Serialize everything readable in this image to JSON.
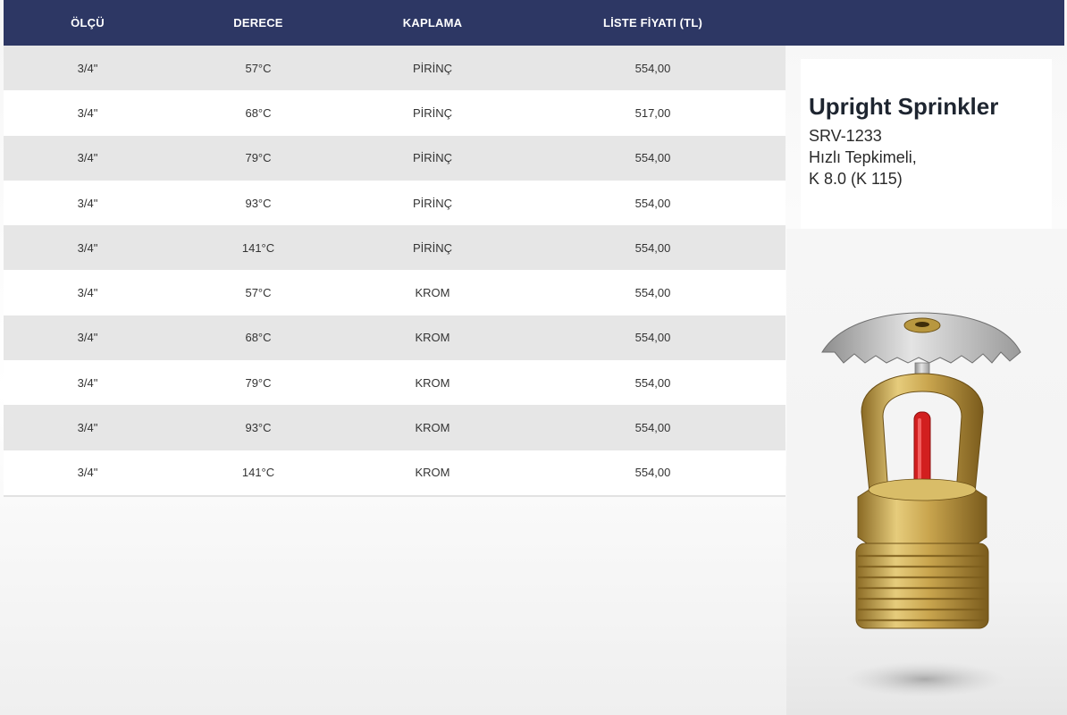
{
  "table": {
    "headers": [
      "ÖLÇÜ",
      "DERECE",
      "KAPLAMA",
      "LİSTE FİYATI (TL)"
    ],
    "rows": [
      [
        "3/4\"",
        "57°C",
        "PİRİNÇ",
        "554,00"
      ],
      [
        "3/4\"",
        "68°C",
        "PİRİNÇ",
        "517,00"
      ],
      [
        "3/4\"",
        "79°C",
        "PİRİNÇ",
        "554,00"
      ],
      [
        "3/4\"",
        "93°C",
        "PİRİNÇ",
        "554,00"
      ],
      [
        "3/4\"",
        "141°C",
        "PİRİNÇ",
        "554,00"
      ],
      [
        "3/4\"",
        "57°C",
        "KROM",
        "554,00"
      ],
      [
        "3/4\"",
        "68°C",
        "KROM",
        "554,00"
      ],
      [
        "3/4\"",
        "79°C",
        "KROM",
        "554,00"
      ],
      [
        "3/4\"",
        "93°C",
        "KROM",
        "554,00"
      ],
      [
        "3/4\"",
        "141°C",
        "KROM",
        "554,00"
      ]
    ]
  },
  "product": {
    "title": "Upright Sprinkler",
    "code": "SRV-1233",
    "response": "Hızlı Tepkimeli,",
    "k_factor": "K 8.0 (K 115)"
  },
  "colors": {
    "header_bg": "#2d3764",
    "row_alt_bg": "#e6e6e6",
    "brass": "#c8a64a",
    "bulb": "#d21f1f"
  },
  "icons": {
    "product_image": "upright-sprinkler-image"
  }
}
